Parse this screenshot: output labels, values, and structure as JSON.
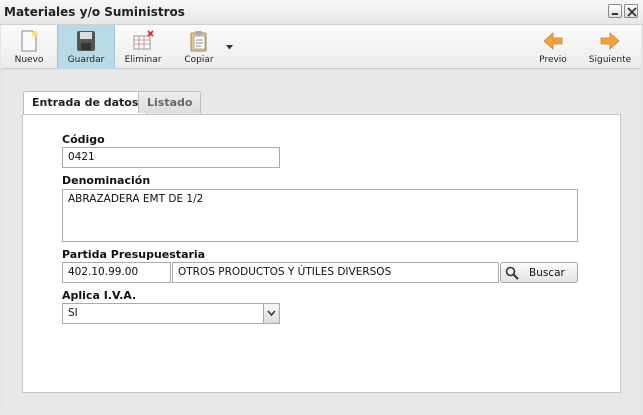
{
  "window": {
    "title": "Materiales y/o Suministros"
  },
  "toolbar": {
    "nuevo": "Nuevo",
    "guardar": "Guardar",
    "eliminar": "Eliminar",
    "copiar": "Copiar",
    "previo": "Previo",
    "siguiente": "Siguiente"
  },
  "tabs": [
    {
      "label": "Entrada de datos",
      "active": true
    },
    {
      "label": "Listado",
      "active": false
    }
  ],
  "form": {
    "codigo_label": "Código",
    "codigo_value": "0421",
    "denominacion_label": "Denominación",
    "denominacion_value": "ABRAZADERA EMT DE 1/2",
    "partida_label": "Partida Presupuestaria",
    "partida_code": "402.10.99.00",
    "partida_desc": "OTROS PRODUCTOS Y ÚTILES DIVERSOS",
    "buscar_label": "Buscar",
    "iva_label": "Aplica I.V.A.",
    "iva_value": "SI"
  },
  "colors": {
    "active_tool": "#b9dbe8",
    "arrow": "#f0a23c"
  }
}
